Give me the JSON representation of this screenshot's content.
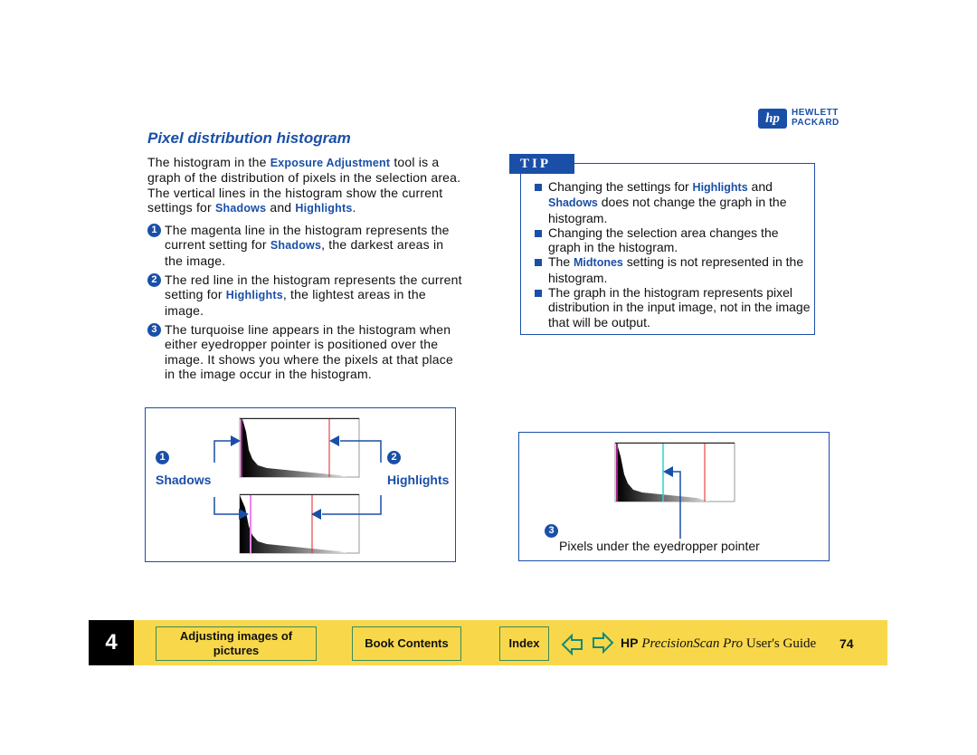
{
  "logo": {
    "line1": "HEWLETT",
    "line2": "PACKARD",
    "mark": "hp"
  },
  "title": "Pixel distribution histogram",
  "intro": {
    "t1": "The histogram in the ",
    "l1": "Exposure Adjustment",
    "t2": " tool is a graph of the distribution of pixels in the selection area. The vertical lines in the histogram show the current settings for ",
    "l2": "Shadows",
    "t3": " and ",
    "l3": "Highlights",
    "t4": "."
  },
  "items": [
    {
      "num": "1",
      "t1": "The magenta line in the histogram represents the current setting for ",
      "link": "Shadows",
      "t2": ", the darkest areas in the image."
    },
    {
      "num": "2",
      "t1": "The red line in the histogram represents the current setting for ",
      "link": "Highlights",
      "t2": ", the lightest areas in the image."
    },
    {
      "num": "3",
      "t1": "The turquoise line appears in the histogram when either eyedropper pointer is positioned over the image. It shows you where the pixels at that place in the image occur in the histogram.",
      "link": "",
      "t2": ""
    }
  ],
  "tip": {
    "label": "TIP",
    "bullets": [
      {
        "t1": "Changing the settings for ",
        "l1": "Highlights",
        "t2": " and ",
        "l2": "Shadows",
        "t3": " does not change the graph in the histogram."
      },
      {
        "t1": "Changing the selection area changes the graph in the histogram.",
        "l1": "",
        "t2": "",
        "l2": "",
        "t3": ""
      },
      {
        "t1": "The ",
        "l1": "Midtones",
        "t2": " setting is not represented in the histogram.",
        "l2": "",
        "t3": ""
      },
      {
        "t1": "The graph in the histogram represents pixel distribution in the input image, not in the image that will be output.",
        "l1": "",
        "t2": "",
        "l2": "",
        "t3": ""
      }
    ]
  },
  "figure1": {
    "num1": "1",
    "label1": "Shadows",
    "num2": "2",
    "label2": "Highlights"
  },
  "figure2": {
    "num": "3",
    "caption": "Pixels under the eyedropper pointer"
  },
  "colors": {
    "magenta": "#a0208a",
    "red": "#e02020",
    "turquoise": "#30d0d0",
    "accent": "#1a4fa8",
    "footer": "#f8d84a"
  },
  "footer": {
    "chapter": "4",
    "section": "Adjusting images of pictures",
    "contents": "Book Contents",
    "index": "Index",
    "brand": "HP",
    "product": "PrecisionScan Pro",
    "guide": " User's Guide",
    "page": "74",
    "prev_icon": "arrow-left-icon",
    "next_icon": "arrow-right-icon"
  }
}
